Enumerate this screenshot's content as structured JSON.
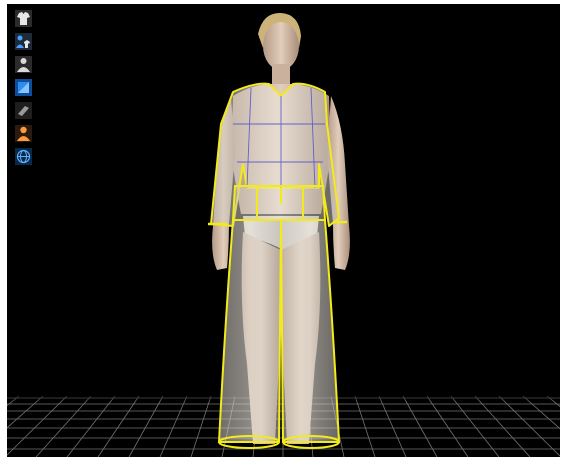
{
  "viewport": {
    "background": "#000000",
    "garment_outline_color": "#f2ea1a",
    "pattern_line_color": "#5a55c8"
  },
  "toolbar": {
    "tools": [
      {
        "icon": "garment-display-icon"
      },
      {
        "icon": "avatar-garment-toggle-icon"
      },
      {
        "icon": "avatar-display-icon"
      },
      {
        "icon": "texture-view-icon"
      },
      {
        "icon": "fabric-view-icon"
      },
      {
        "icon": "avatar-skin-icon"
      },
      {
        "icon": "grid-globe-icon"
      }
    ]
  }
}
